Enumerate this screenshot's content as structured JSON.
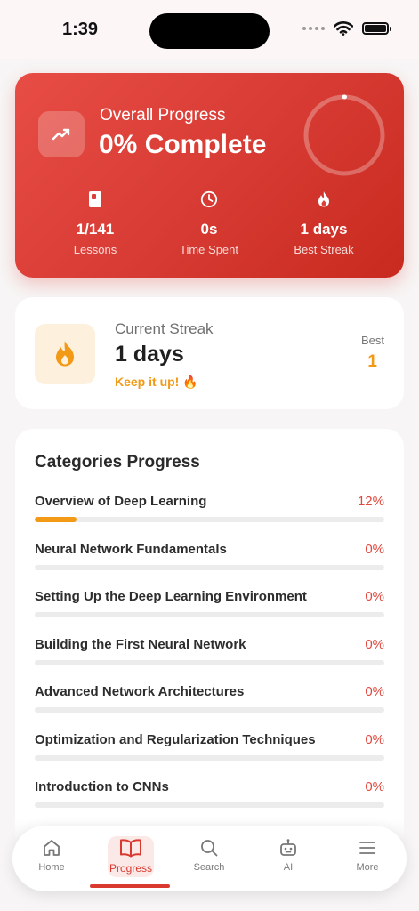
{
  "status_bar": {
    "time": "1:39"
  },
  "overall": {
    "label": "Overall Progress",
    "percent_text": "0% Complete",
    "progress_fraction": 0.0,
    "stats": [
      {
        "icon": "book-icon",
        "value": "1/141",
        "label": "Lessons"
      },
      {
        "icon": "clock-icon",
        "value": "0s",
        "label": "Time Spent"
      },
      {
        "icon": "flame-icon",
        "value": "1 days",
        "label": "Best Streak"
      }
    ]
  },
  "streak": {
    "title": "Current Streak",
    "value": "1 days",
    "subtitle": "Keep it up! 🔥",
    "best_label": "Best",
    "best_value": "1"
  },
  "categories": {
    "title": "Categories Progress",
    "items": [
      {
        "name": "Overview of Deep Learning",
        "percent": "12%",
        "progress": 0.12
      },
      {
        "name": "Neural Network Fundamentals",
        "percent": "0%",
        "progress": 0
      },
      {
        "name": "Setting Up the Deep Learning Environment",
        "percent": "0%",
        "progress": 0
      },
      {
        "name": "Building the First Neural Network",
        "percent": "0%",
        "progress": 0
      },
      {
        "name": "Advanced Network Architectures",
        "percent": "0%",
        "progress": 0
      },
      {
        "name": "Optimization and Regularization Techniques",
        "percent": "0%",
        "progress": 0
      },
      {
        "name": "Introduction to CNNs",
        "percent": "0%",
        "progress": 0
      }
    ]
  },
  "nav": {
    "items": [
      {
        "label": "Home",
        "icon": "home-icon"
      },
      {
        "label": "Progress",
        "icon": "open-book-icon"
      },
      {
        "label": "Search",
        "icon": "search-icon"
      },
      {
        "label": "AI",
        "icon": "robot-icon"
      },
      {
        "label": "More",
        "icon": "menu-icon"
      }
    ],
    "active": "Progress"
  },
  "colors": {
    "accent_red": "#d9392f",
    "accent_orange": "#f29a16",
    "card_gradient_start": "#e84d45",
    "card_gradient_end": "#c92a1f"
  }
}
